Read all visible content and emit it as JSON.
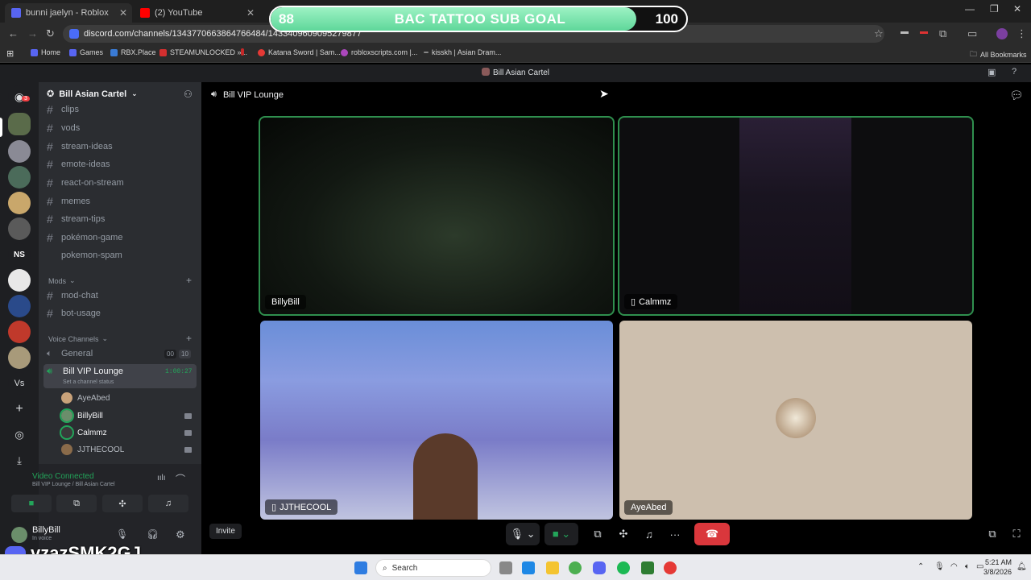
{
  "browser": {
    "tabs": [
      {
        "label": "bunni jaelyn - Roblox",
        "color": "#5865f2"
      },
      {
        "label": "(2) YouTube",
        "color": "#ff0000"
      }
    ],
    "url": "discord.com/channels/1343770663864766484/1433409609095279877",
    "bookmarks": [
      {
        "label": "Home",
        "color": "#5865f2"
      },
      {
        "label": "Games",
        "color": "#5865f2"
      },
      {
        "label": "RBX.Place",
        "color": "#3a7bd5"
      },
      {
        "label": "STEAMUNLOCKED »...",
        "color": "#d32f2f"
      },
      {
        "label": "",
        "color": "#c62828"
      },
      {
        "label": "Katana Sword | Sam...",
        "color": "#e53935"
      },
      {
        "label": "robloxscripts.com |...",
        "color": "#ab47bc"
      },
      {
        "label": "kisskh | Asian Dram...",
        "color": "#888888"
      }
    ],
    "all_bookmarks": "All Bookmarks"
  },
  "overlay": {
    "current": "88",
    "title": "BAC TATTOO SUB GOAL",
    "target": "100",
    "progress": 0.88
  },
  "discord": {
    "window_title": "Bill Asian Cartel",
    "server_name": "Bill Asian Cartel",
    "server_badge": "3",
    "rail_ns": "NS",
    "rail_vs": "Vs",
    "channels": [
      {
        "label": "clips"
      },
      {
        "label": "vods"
      },
      {
        "label": "stream-ideas"
      },
      {
        "label": "emote-ideas"
      },
      {
        "label": "react-on-stream"
      },
      {
        "label": "memes"
      },
      {
        "label": "stream-tips"
      },
      {
        "label": "pokémon-game"
      },
      {
        "label": "pokemon-spam"
      }
    ],
    "mods_category": "Mods",
    "mod_channels": [
      {
        "label": "mod-chat"
      },
      {
        "label": "bot-usage"
      }
    ],
    "voice_category": "Voice Channels",
    "general": {
      "label": "General",
      "count_a": "00",
      "count_b": "10"
    },
    "vip": {
      "label": "Bill VIP Lounge",
      "timer": "1:00:27",
      "status": "Set a channel status"
    },
    "members": [
      {
        "name": "AyeAbed",
        "color": "#c9a27a",
        "cam": false
      },
      {
        "name": "BillyBill",
        "color": "#6b8e6b",
        "cam": true
      },
      {
        "name": "Calmmz",
        "color": "#3a3a3a",
        "cam": true
      },
      {
        "name": "JJTHECOOL",
        "color": "#8a6b4a",
        "cam": true
      }
    ],
    "voice_panel": {
      "status": "Video Connected",
      "location": "Bill VIP Lounge / Bill Asian Cartel"
    },
    "user": {
      "name": "BillyBill",
      "status": "In voice"
    },
    "stage_channel": "Bill VIP Lounge",
    "tiles": [
      {
        "name": "BillyBill"
      },
      {
        "name": "Calmmz"
      },
      {
        "name": "JJTHECOOL"
      },
      {
        "name": "AyeAbed"
      }
    ],
    "invite": "Invite"
  },
  "watermark": "vzazSMK2GJ",
  "taskbar": {
    "search": "Search",
    "time": "5:21 AM",
    "date": "3/8/2026"
  }
}
